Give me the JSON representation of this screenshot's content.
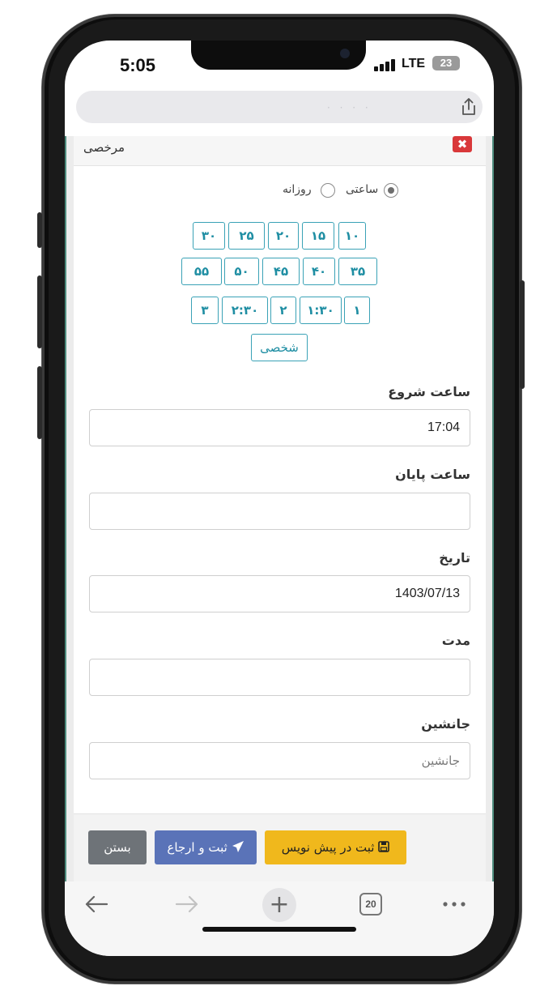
{
  "status": {
    "time": "5:05",
    "network": "LTE",
    "battery": "23"
  },
  "browser": {
    "url_hint": "· · · ·",
    "tab_count": "20"
  },
  "modal": {
    "title": "مرخصی",
    "close_symbol": "✖"
  },
  "type_options": [
    {
      "label": "ساعتی",
      "checked": true
    },
    {
      "label": "روزانه",
      "checked": false
    }
  ],
  "quick_chips": {
    "row1": [
      "۳۰",
      "۲۵",
      "۲۰",
      "۱۵",
      "۱۰"
    ],
    "row2": [
      "۵۵",
      "۵۰",
      "۴۵",
      "۴۰",
      "۳۵"
    ],
    "row3": [
      "۳",
      "۲:۳۰",
      "۲",
      "۱:۳۰",
      "۱"
    ],
    "row4": [
      "شخصی"
    ]
  },
  "fields": {
    "start": {
      "label": "ساعت شروع",
      "value": "17:04"
    },
    "end": {
      "label": "ساعت پایان",
      "value": ""
    },
    "date": {
      "label": "تاریخ",
      "value": "1403/07/13"
    },
    "duration": {
      "label": "مدت",
      "value": ""
    },
    "substitute": {
      "label": "جانشین",
      "placeholder": "جانشین"
    }
  },
  "footer": {
    "close": "بستن",
    "submit": "ثبت و ارجاع",
    "draft": "ثبت در پیش نویس"
  },
  "colors": {
    "accent": "#1f8ea3",
    "submit": "#5a73b8",
    "draft": "#f0b81c",
    "close": "#6e7378",
    "danger": "#d9383a"
  }
}
